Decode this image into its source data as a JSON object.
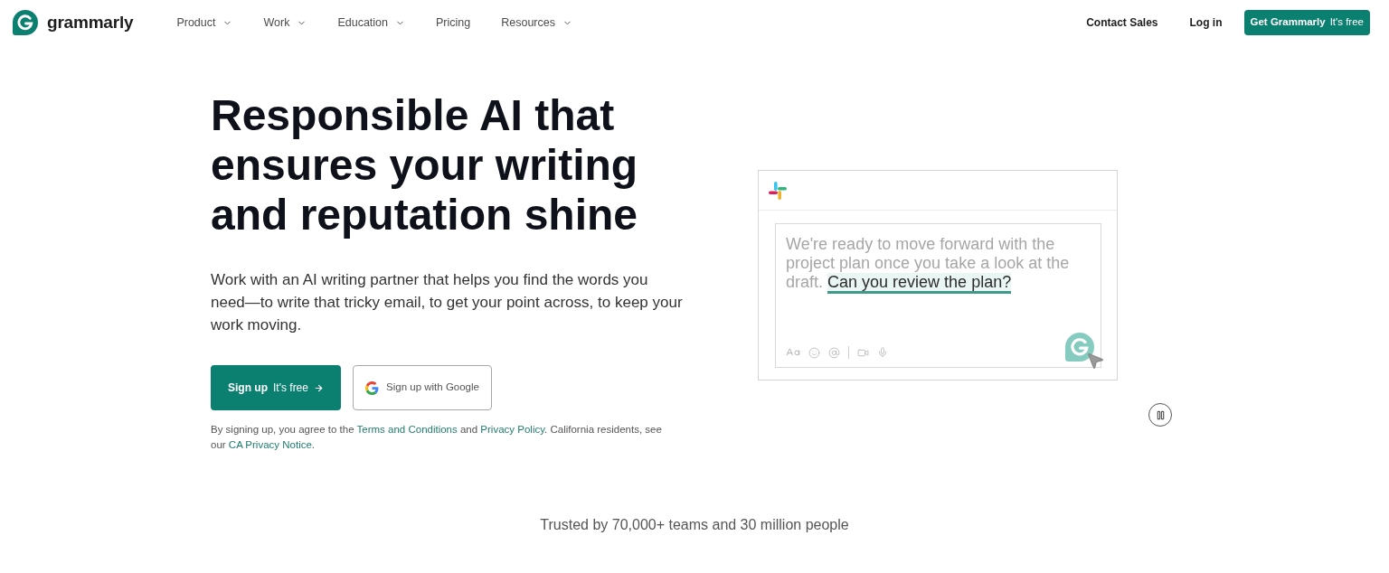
{
  "nav": {
    "logo": {
      "wordmark": "grammarly"
    },
    "menu": [
      {
        "label": "Product",
        "dropdown": true
      },
      {
        "label": "Work",
        "dropdown": true
      },
      {
        "label": "Education",
        "dropdown": true
      },
      {
        "label": "Pricing",
        "dropdown": false
      },
      {
        "label": "Resources",
        "dropdown": true
      }
    ],
    "links": [
      "Contact Sales",
      "Log in"
    ],
    "cta": {
      "label": "Get Grammarly",
      "note": "It's free"
    }
  },
  "hero": {
    "title": "Responsible AI that ensures your writing and reputation shine",
    "description": "Work with an AI writing partner that helps you find the words you need—to write that tricky email, to get your point across, to keep your work moving.",
    "primary_button": {
      "label": "Sign up",
      "note": "It's free"
    },
    "google_button": {
      "label": "Sign up with Google"
    },
    "legal": [
      {
        "kind": "text",
        "text": "By signing up, you agree to the "
      },
      {
        "kind": "link",
        "text": "Terms and Conditions"
      },
      {
        "kind": "text",
        "text": " and "
      },
      {
        "kind": "link",
        "text": "Privacy Policy"
      },
      {
        "kind": "text",
        "text": ". California residents, see our "
      },
      {
        "kind": "link",
        "text": "CA Privacy Notice"
      },
      {
        "kind": "text",
        "text": "."
      }
    ]
  },
  "demo": {
    "message": "We're ready to move forward with the project plan once you take a look at the draft.",
    "suggestion": "Can you review the plan?"
  },
  "trust_line": "Trusted by 70,000+ teams and 30 million people"
}
